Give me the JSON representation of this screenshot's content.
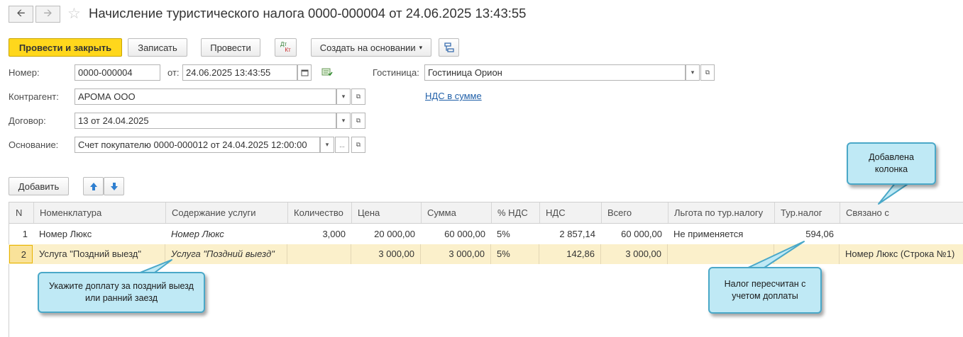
{
  "header": {
    "title": "Начисление туристического налога 0000-000004 от 24.06.2025 13:43:55",
    "back_icon": "arrow-left-icon",
    "forward_icon": "arrow-right-icon"
  },
  "toolbar": {
    "post_close": "Провести и закрыть",
    "save": "Записать",
    "post": "Провести",
    "dtkt_top": "Дт",
    "dtkt_bottom": "Кт",
    "create_based": "Создать на основании",
    "create_based_arrow": "▾"
  },
  "form": {
    "number_label": "Номер:",
    "number_value": "0000-000004",
    "date_label": "от:",
    "date_value": "24.06.2025 13:43:55",
    "hotel_label": "Гостиница:",
    "hotel_value": "Гостиница Орион",
    "counterparty_label": "Контрагент:",
    "counterparty_value": "АРОМА ООО",
    "vat_link": "НДС в сумме",
    "contract_label": "Договор:",
    "contract_value": "13 от 24.04.2025",
    "basis_label": "Основание:",
    "basis_value": "Счет покупателю 0000-000012 от 24.04.2025 12:00:00",
    "ellipsis": "..."
  },
  "table_toolbar": {
    "add": "Добавить"
  },
  "table": {
    "columns": [
      "N",
      "Номенклатура",
      "Содержание услуги",
      "Количество",
      "Цена",
      "Сумма",
      "% НДС",
      "НДС",
      "Всего",
      "Льгота по тур.налогу",
      "Тур.налог",
      "Связано с"
    ],
    "rows": [
      {
        "n": "1",
        "item": "Номер Люкс",
        "content": "Номер Люкс",
        "qty": "3,000",
        "price": "20 000,00",
        "sum": "60 000,00",
        "vat_rate": "5%",
        "vat": "2 857,14",
        "total": "60 000,00",
        "benefit": "Не применяется",
        "tax": "594,06",
        "linked": ""
      },
      {
        "n": "2",
        "item": "Услуга \"Поздний выезд\"",
        "content": "Услуга \"Поздний выезд\"",
        "qty": "",
        "price": "3 000,00",
        "sum": "3 000,00",
        "vat_rate": "5%",
        "vat": "142,86",
        "total": "3 000,00",
        "benefit": "",
        "tax": "",
        "linked": "Номер Люкс (Строка №1)"
      }
    ]
  },
  "callouts": {
    "added_column": "Добавлена колонка",
    "surcharge": "Укажите доплату за поздний выезд или ранний заезд",
    "recalculated": "Налог пересчитан с учетом доплаты"
  },
  "colors": {
    "primary_button": "#ffd71c",
    "selected_row": "#fbf0cb",
    "callout_fill": "#bfe9f5",
    "callout_border": "#4aa8c8",
    "link": "#1f5fa8"
  }
}
